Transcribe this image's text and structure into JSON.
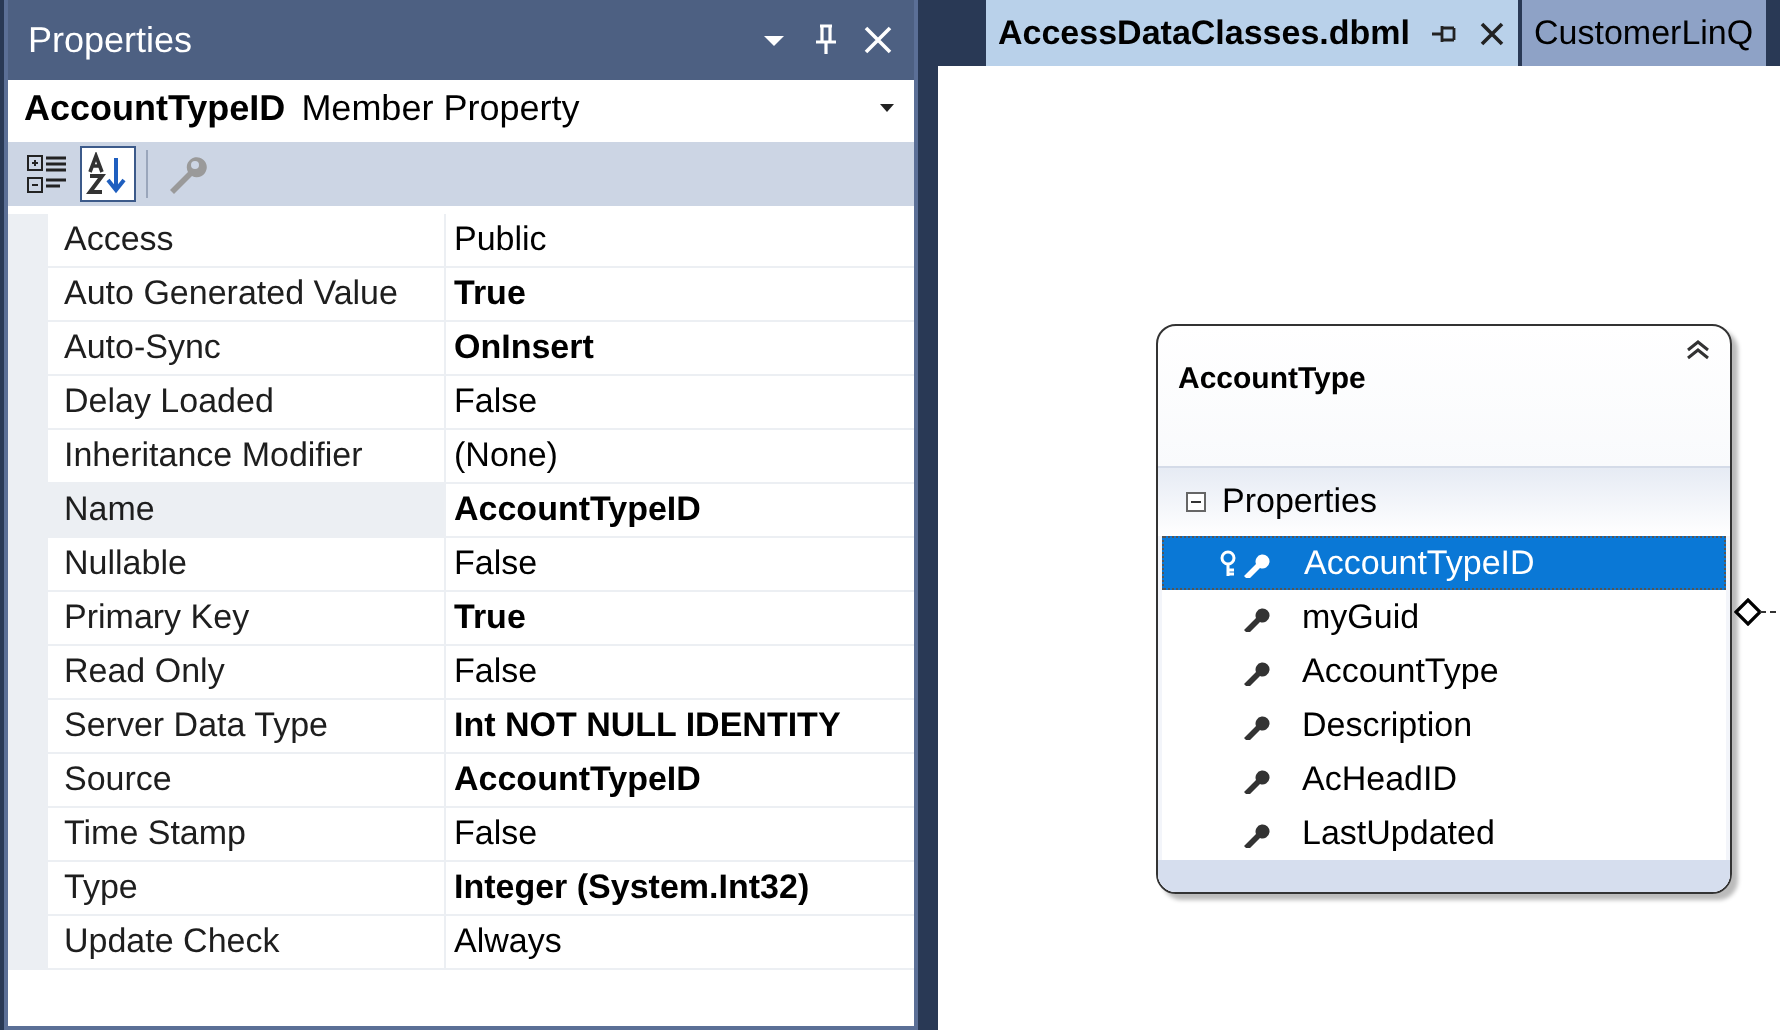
{
  "properties_panel": {
    "title": "Properties",
    "object": {
      "name": "AccountTypeID",
      "type": "Member Property"
    },
    "toolbar": [
      {
        "kind": "categorized",
        "selected": false
      },
      {
        "kind": "alphabetical",
        "selected": true
      },
      {
        "kind": "wrench",
        "selected": false
      }
    ],
    "rows": [
      {
        "label": "Access",
        "value": "Public",
        "modified": false,
        "selected": false
      },
      {
        "label": "Auto Generated Value",
        "value": "True",
        "modified": true,
        "selected": false
      },
      {
        "label": "Auto-Sync",
        "value": "OnInsert",
        "modified": true,
        "selected": false
      },
      {
        "label": "Delay Loaded",
        "value": "False",
        "modified": false,
        "selected": false
      },
      {
        "label": "Inheritance Modifier",
        "value": "(None)",
        "modified": false,
        "selected": false
      },
      {
        "label": "Name",
        "value": "AccountTypeID",
        "modified": true,
        "selected": true
      },
      {
        "label": "Nullable",
        "value": "False",
        "modified": false,
        "selected": false
      },
      {
        "label": "Primary Key",
        "value": "True",
        "modified": true,
        "selected": false
      },
      {
        "label": "Read Only",
        "value": "False",
        "modified": false,
        "selected": false
      },
      {
        "label": "Server Data Type",
        "value": "Int NOT NULL IDENTITY",
        "modified": true,
        "selected": false
      },
      {
        "label": "Source",
        "value": "AccountTypeID",
        "modified": true,
        "selected": false
      },
      {
        "label": "Time Stamp",
        "value": "False",
        "modified": false,
        "selected": false
      },
      {
        "label": "Type",
        "value": "Integer (System.Int32)",
        "modified": true,
        "selected": false
      },
      {
        "label": "Update Check",
        "value": "Always",
        "modified": false,
        "selected": false
      }
    ]
  },
  "tabs": [
    {
      "label": "AccessDataClasses.dbml",
      "selected": true
    },
    {
      "label": "CustomerLinQ",
      "selected": false
    }
  ],
  "entity": {
    "title": "AccountType",
    "section": "Properties",
    "expanded": true,
    "members": [
      {
        "name": "AccountTypeID",
        "kind": "key",
        "selected": true
      },
      {
        "name": "myGuid",
        "kind": "property",
        "selected": false
      },
      {
        "name": "AccountType",
        "kind": "property",
        "selected": false
      },
      {
        "name": "Description",
        "kind": "property",
        "selected": false
      },
      {
        "name": "AcHeadID",
        "kind": "property",
        "selected": false
      },
      {
        "name": "LastUpdated",
        "kind": "property",
        "selected": false
      }
    ]
  }
}
